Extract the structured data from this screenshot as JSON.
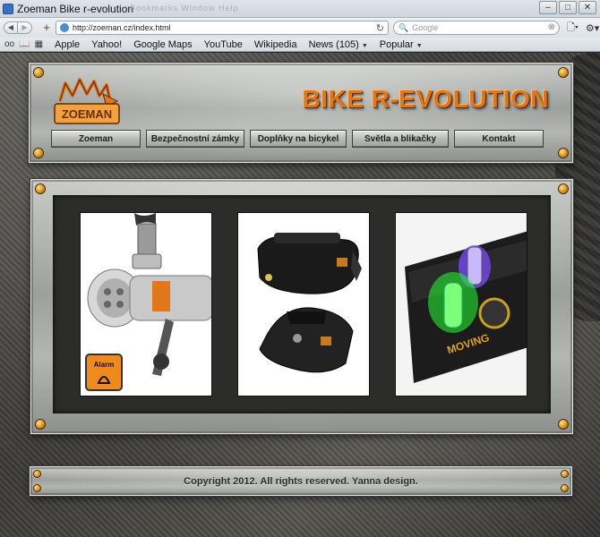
{
  "window": {
    "title": "Zoeman Bike r-evolution",
    "ghost_menu": "Bookmarks  Window  Help",
    "buttons": [
      "–",
      "□",
      "✕"
    ]
  },
  "toolbar": {
    "url": "http://zoeman.cz/index.html",
    "search_placeholder": "Google",
    "icons": [
      "back-icon",
      "forward-icon",
      "add-icon",
      "reload-icon",
      "search-icon",
      "page-icon",
      "gear-icon"
    ]
  },
  "bookmarks": {
    "items": [
      {
        "label": "Apple"
      },
      {
        "label": "Yahoo!"
      },
      {
        "label": "Google Maps"
      },
      {
        "label": "YouTube"
      },
      {
        "label": "Wikipedia"
      },
      {
        "label": "News (105)",
        "dropdown": true
      },
      {
        "label": "Popular",
        "dropdown": true
      }
    ]
  },
  "site": {
    "logo_text": "ZOEMAN",
    "title": "BIKE R-EVOLUTION",
    "nav": [
      {
        "label": "Zoeman"
      },
      {
        "label": "Bezpečnostní zámky"
      },
      {
        "label": "Doplňky na bicykel"
      },
      {
        "label": "Světla a blikačky"
      },
      {
        "label": "Kontakt"
      }
    ],
    "gallery": [
      {
        "name": "bike-alarm",
        "badge": "Alarm"
      },
      {
        "name": "saddle-bag"
      },
      {
        "name": "wheel-lights",
        "caption": "MOVING"
      }
    ],
    "footer": "Copyright 2012. All rights reserved. Yanna design."
  },
  "colors": {
    "accent_orange": "#e2761a",
    "rivet": "#e08f12",
    "metal": "#b4b6b2",
    "gallery_bg": "#2c2c2b"
  }
}
